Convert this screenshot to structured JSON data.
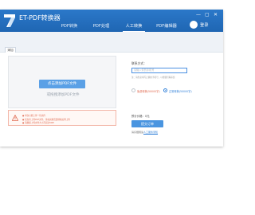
{
  "app": {
    "title": "ET-PDF转换器",
    "login_label": "登录",
    "window_controls": [
      "—",
      "▢",
      "✕"
    ]
  },
  "nav": {
    "items": [
      "PDF转换",
      "PDF处理",
      "人工转换",
      "PDF编辑器"
    ],
    "active_index": 2
  },
  "subtab": {
    "label": "添加"
  },
  "upload": {
    "button_label": "点击添加PDF文件",
    "drag_hint": "或拖拽添加PDF文件"
  },
  "notice": {
    "lines": [
      "● 单次只能上传一份文件",
      "● 仅支持上传PDF文件，请在其他页面转换后再上传",
      "● 请确保上传文件大小不超过50M"
    ]
  },
  "form": {
    "contact_label": "联系方式：",
    "contact_placeholder": "请输入你的手机号",
    "contact_hint": "注：请务必填写正确的手机号，以便我们联系您",
    "options": [
      {
        "label": "免费转换(50000字)",
        "checked": false,
        "color": "#e0684e"
      },
      {
        "label": "正常转换(50000字)",
        "checked": true,
        "color": "#2f7fd8"
      }
    ],
    "price_label": "预计价格：0元",
    "submit_label": "提交订单",
    "service_prefix": "请仔细阅读",
    "service_link": "人工服务须知"
  },
  "colors": {
    "titlebar": "#2472c2",
    "accent": "#4a95e0",
    "warning": "#e0684e"
  }
}
